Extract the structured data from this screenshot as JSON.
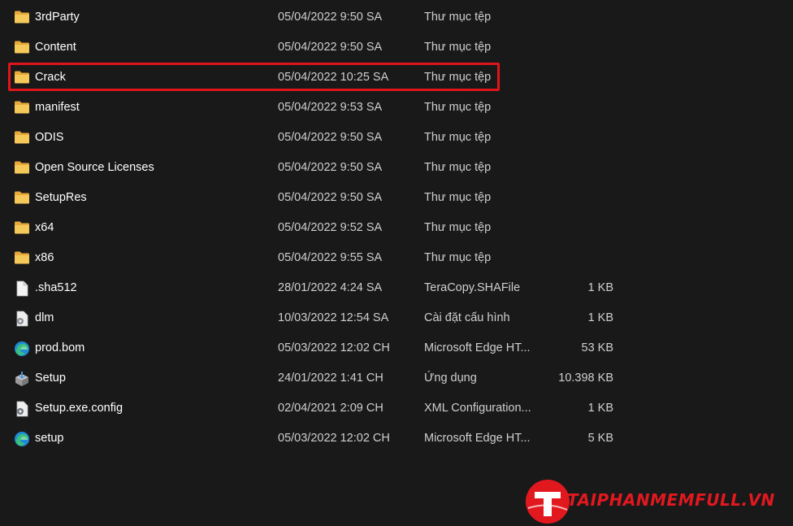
{
  "files": [
    {
      "name": "3rdParty",
      "date": "05/04/2022 9:50 SA",
      "type": "Thư mục tệp",
      "size": "",
      "icon": "folder-icon"
    },
    {
      "name": "Content",
      "date": "05/04/2022 9:50 SA",
      "type": "Thư mục tệp",
      "size": "",
      "icon": "folder-icon"
    },
    {
      "name": "Crack",
      "date": "05/04/2022 10:25 SA",
      "type": "Thư mục tệp",
      "size": "",
      "icon": "folder-icon",
      "highlighted": true
    },
    {
      "name": "manifest",
      "date": "05/04/2022 9:53 SA",
      "type": "Thư mục tệp",
      "size": "",
      "icon": "folder-icon"
    },
    {
      "name": "ODIS",
      "date": "05/04/2022 9:50 SA",
      "type": "Thư mục tệp",
      "size": "",
      "icon": "folder-icon"
    },
    {
      "name": "Open Source Licenses",
      "date": "05/04/2022 9:50 SA",
      "type": "Thư mục tệp",
      "size": "",
      "icon": "folder-icon"
    },
    {
      "name": "SetupRes",
      "date": "05/04/2022 9:50 SA",
      "type": "Thư mục tệp",
      "size": "",
      "icon": "folder-icon"
    },
    {
      "name": "x64",
      "date": "05/04/2022 9:52 SA",
      "type": "Thư mục tệp",
      "size": "",
      "icon": "folder-icon"
    },
    {
      "name": "x86",
      "date": "05/04/2022 9:55 SA",
      "type": "Thư mục tệp",
      "size": "",
      "icon": "folder-icon"
    },
    {
      "name": ".sha512",
      "date": "28/01/2022 4:24 SA",
      "type": "TeraCopy.SHAFile",
      "size": "1 KB",
      "icon": "file-icon"
    },
    {
      "name": "dlm",
      "date": "10/03/2022 12:54 SA",
      "type": "Cài đặt cấu hình",
      "size": "1 KB",
      "icon": "config-file-icon"
    },
    {
      "name": "prod.bom",
      "date": "05/03/2022 12:02 CH",
      "type": "Microsoft Edge HT...",
      "size": "53 KB",
      "icon": "edge-icon"
    },
    {
      "name": "Setup",
      "date": "24/01/2022 1:41 CH",
      "type": "Ứng dụng",
      "size": "10.398 KB",
      "icon": "installer-icon"
    },
    {
      "name": "Setup.exe.config",
      "date": "02/04/2021 2:09 CH",
      "type": "XML Configuration...",
      "size": "1 KB",
      "icon": "xml-file-icon"
    },
    {
      "name": "setup",
      "date": "05/03/2022 12:02 CH",
      "type": "Microsoft Edge HT...",
      "size": "5 KB",
      "icon": "edge-icon"
    }
  ],
  "watermark": {
    "text": "TAIPHANMEMFULL.VN",
    "logo_letter": "T"
  },
  "colors": {
    "background": "#191919",
    "highlight": "#e0141b",
    "folder": "#f2c14e",
    "watermark": "#e2181f"
  }
}
